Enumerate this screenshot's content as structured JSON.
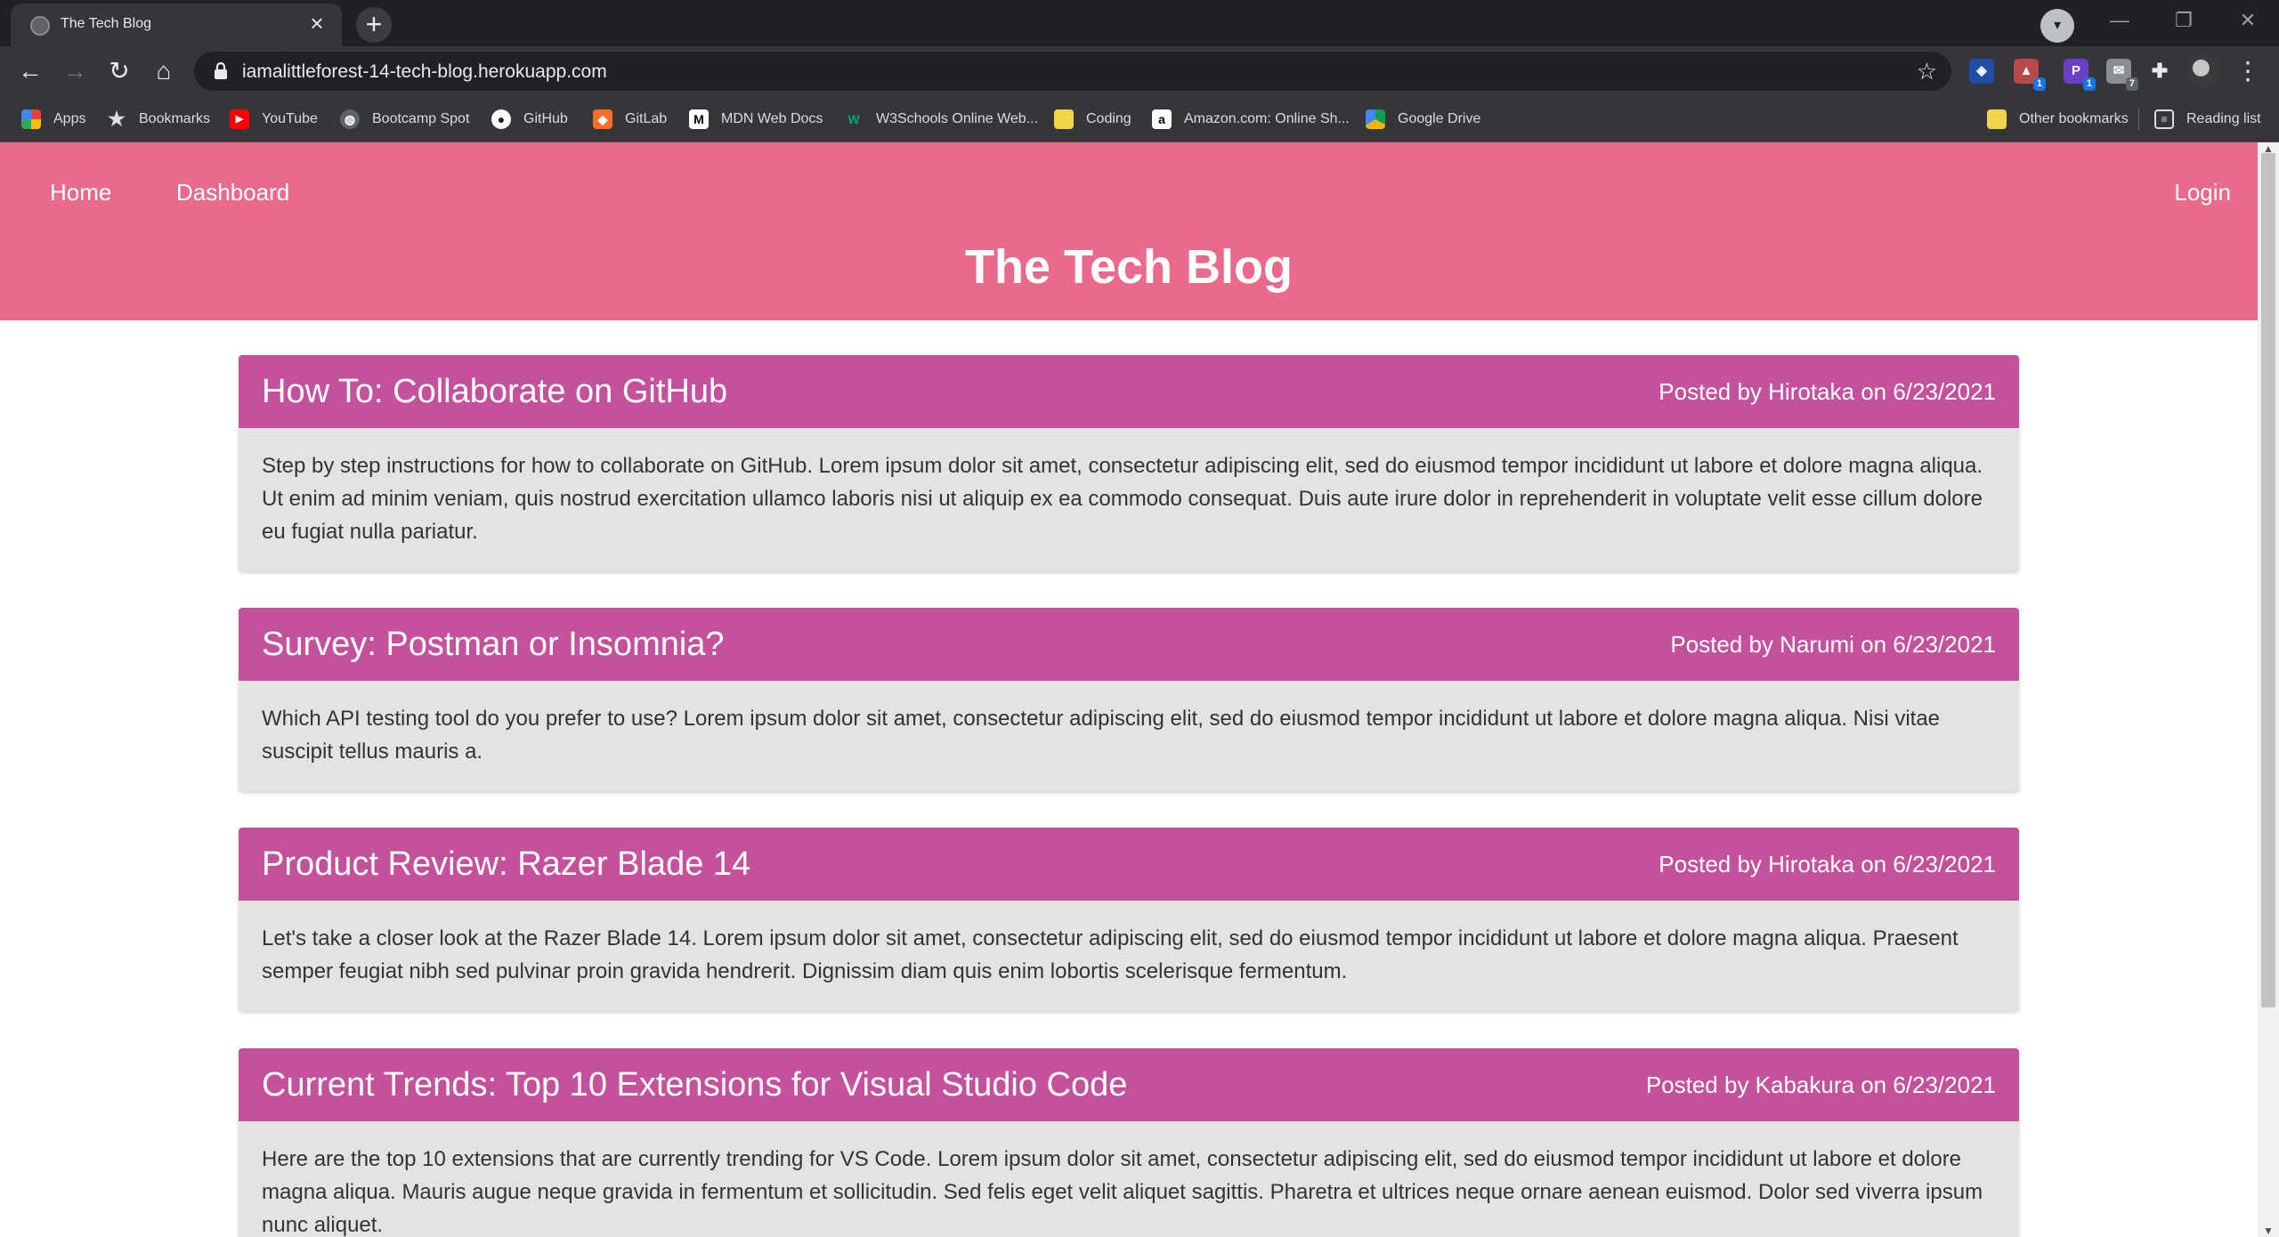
{
  "browser": {
    "tab_title": "The Tech Blog",
    "url": "iamalittleforest-14-tech-blog.herokuapp.com",
    "bookmarks": [
      {
        "label": "Apps",
        "icon": "apps-grid-icon"
      },
      {
        "label": "Bookmarks",
        "icon": "star-icon"
      },
      {
        "label": "YouTube",
        "icon": "youtube-icon"
      },
      {
        "label": "Bootcamp Spot",
        "icon": "globe-icon"
      },
      {
        "label": "GitHub",
        "icon": "github-icon"
      },
      {
        "label": "GitLab",
        "icon": "gitlab-icon"
      },
      {
        "label": "MDN Web Docs",
        "icon": "mdn-icon"
      },
      {
        "label": "W3Schools Online Web...",
        "icon": "w3schools-icon"
      },
      {
        "label": "Coding",
        "icon": "folder-icon"
      },
      {
        "label": "Amazon.com: Online Sh...",
        "icon": "amazon-icon"
      },
      {
        "label": "Google Drive",
        "icon": "google-drive-icon"
      }
    ],
    "other_bookmarks": "Other bookmarks",
    "reading_list": "Reading list",
    "extension_badges": [
      "1",
      "1",
      "7"
    ]
  },
  "site": {
    "nav": {
      "home": "Home",
      "dashboard": "Dashboard",
      "login": "Login"
    },
    "title": "The Tech Blog"
  },
  "posts": [
    {
      "title": "How To: Collaborate on GitHub",
      "meta": "Posted by Hirotaka on 6/23/2021",
      "body": "Step by step instructions for how to collaborate on GitHub. Lorem ipsum dolor sit amet, consectetur adipiscing elit, sed do eiusmod tempor incididunt ut labore et dolore magna aliqua. Ut enim ad minim veniam, quis nostrud exercitation ullamco laboris nisi ut aliquip ex ea commodo consequat. Duis aute irure dolor in reprehenderit in voluptate velit esse cillum dolore eu fugiat nulla pariatur."
    },
    {
      "title": "Survey: Postman or Insomnia?",
      "meta": "Posted by Narumi on 6/23/2021",
      "body": "Which API testing tool do you prefer to use? Lorem ipsum dolor sit amet, consectetur adipiscing elit, sed do eiusmod tempor incididunt ut labore et dolore magna aliqua. Nisi vitae suscipit tellus mauris a."
    },
    {
      "title": "Product Review: Razer Blade 14",
      "meta": "Posted by Hirotaka on 6/23/2021",
      "body": "Let's take a closer look at the Razer Blade 14. Lorem ipsum dolor sit amet, consectetur adipiscing elit, sed do eiusmod tempor incididunt ut labore et dolore magna aliqua. Praesent semper feugiat nibh sed pulvinar proin gravida hendrerit. Dignissim diam quis enim lobortis scelerisque fermentum."
    },
    {
      "title": "Current Trends: Top 10 Extensions for Visual Studio Code",
      "meta": "Posted by Kabakura on 6/23/2021",
      "body": "Here are the top 10 extensions that are currently trending for VS Code. Lorem ipsum dolor sit amet, consectetur adipiscing elit, sed do eiusmod tempor incididunt ut labore et dolore magna aliqua. Mauris augue neque gravida in fermentum et sollicitudin. Sed felis eget velit aliquet sagittis. Pharetra et ultrices neque ornare aenean euismod. Dolor sed viverra ipsum nunc aliquet."
    }
  ],
  "colors": {
    "header_bg": "#ea6a8c",
    "post_header_bg": "#c3519b",
    "post_body_bg": "#e3e3e3"
  }
}
